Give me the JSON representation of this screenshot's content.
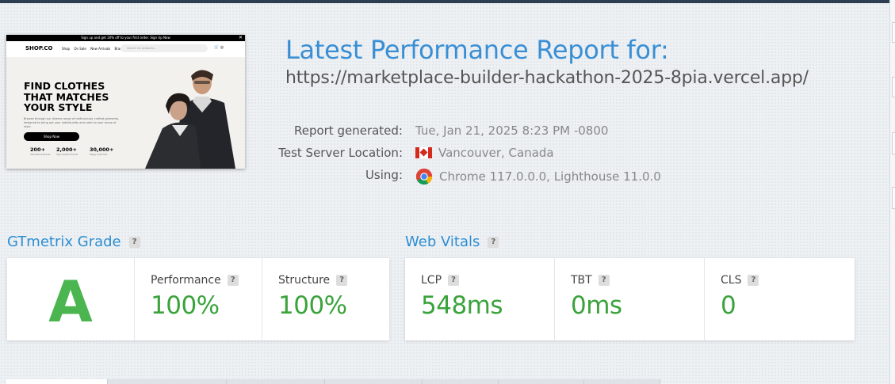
{
  "header": {
    "title": "Latest Performance Report for:",
    "url": "https://marketplace-builder-hackathon-2025-8pia.vercel.app/"
  },
  "meta": {
    "report_generated_label": "Report generated:",
    "report_generated_value": "Tue, Jan 21, 2025 8:23 PM -0800",
    "server_location_label": "Test Server Location:",
    "server_location_value": "Vancouver, Canada",
    "using_label": "Using:",
    "using_value": "Chrome 117.0.0.0, Lighthouse 11.0.0"
  },
  "thumbnail": {
    "promo": "Sign up and get 20% off to your first order. Sign Up Now",
    "close": "✕",
    "logo": "SHOP.CO",
    "nav": [
      "Shop",
      "On Sale",
      "New Arrivals",
      "Brands"
    ],
    "search_placeholder": "Search for products...",
    "icons": "🛒 ◎",
    "hero_title": "FIND CLOTHES THAT MATCHES YOUR STYLE",
    "hero_desc": "Browse through our diverse range of meticulously crafted garments, designed to bring out your individuality and cater to your sense of style.",
    "button": "Shop Now",
    "stats": [
      {
        "value": "200+",
        "label": "International Brands"
      },
      {
        "value": "2,000+",
        "label": "High-Quality Products"
      },
      {
        "value": "30,000+",
        "label": "Happy Customers"
      }
    ]
  },
  "gtmetrix": {
    "heading": "GTmetrix Grade",
    "help": "?",
    "grade": "A",
    "performance_label": "Performance",
    "performance_value": "100%",
    "structure_label": "Structure",
    "structure_value": "100%"
  },
  "web_vitals": {
    "heading": "Web Vitals",
    "help": "?",
    "lcp_label": "LCP",
    "lcp_value": "548ms",
    "tbt_label": "TBT",
    "tbt_value": "0ms",
    "cls_label": "CLS",
    "cls_value": "0"
  },
  "colors": {
    "title_blue": "#3a8fd4",
    "grade_green": "#4bb54f",
    "value_green": "#3aa33c"
  }
}
